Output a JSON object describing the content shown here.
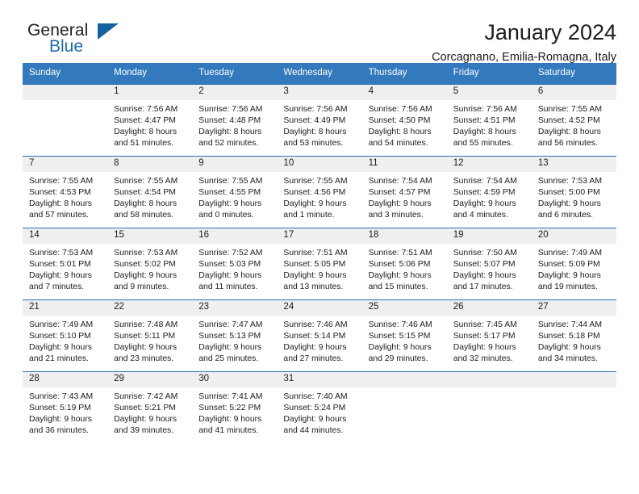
{
  "brand": {
    "name_part1": "General",
    "name_part2": "Blue"
  },
  "header": {
    "title": "January 2024",
    "subtitle": "Corcagnano, Emilia-Romagna, Italy"
  },
  "colors": {
    "header_blue": "#3279bd",
    "row_divider_blue": "#2c6fae",
    "day_band_gray": "#efefef",
    "logo_blue": "#1d6cb5",
    "text": "#1c1c1c"
  },
  "weekdays": [
    "Sunday",
    "Monday",
    "Tuesday",
    "Wednesday",
    "Thursday",
    "Friday",
    "Saturday"
  ],
  "weeks": [
    [
      {
        "day": "",
        "sunrise": "",
        "sunset": "",
        "daylight_line1": "",
        "daylight_line2": ""
      },
      {
        "day": "1",
        "sunrise": "Sunrise: 7:56 AM",
        "sunset": "Sunset: 4:47 PM",
        "daylight_line1": "Daylight: 8 hours",
        "daylight_line2": "and 51 minutes."
      },
      {
        "day": "2",
        "sunrise": "Sunrise: 7:56 AM",
        "sunset": "Sunset: 4:48 PM",
        "daylight_line1": "Daylight: 8 hours",
        "daylight_line2": "and 52 minutes."
      },
      {
        "day": "3",
        "sunrise": "Sunrise: 7:56 AM",
        "sunset": "Sunset: 4:49 PM",
        "daylight_line1": "Daylight: 8 hours",
        "daylight_line2": "and 53 minutes."
      },
      {
        "day": "4",
        "sunrise": "Sunrise: 7:56 AM",
        "sunset": "Sunset: 4:50 PM",
        "daylight_line1": "Daylight: 8 hours",
        "daylight_line2": "and 54 minutes."
      },
      {
        "day": "5",
        "sunrise": "Sunrise: 7:56 AM",
        "sunset": "Sunset: 4:51 PM",
        "daylight_line1": "Daylight: 8 hours",
        "daylight_line2": "and 55 minutes."
      },
      {
        "day": "6",
        "sunrise": "Sunrise: 7:55 AM",
        "sunset": "Sunset: 4:52 PM",
        "daylight_line1": "Daylight: 8 hours",
        "daylight_line2": "and 56 minutes."
      }
    ],
    [
      {
        "day": "7",
        "sunrise": "Sunrise: 7:55 AM",
        "sunset": "Sunset: 4:53 PM",
        "daylight_line1": "Daylight: 8 hours",
        "daylight_line2": "and 57 minutes."
      },
      {
        "day": "8",
        "sunrise": "Sunrise: 7:55 AM",
        "sunset": "Sunset: 4:54 PM",
        "daylight_line1": "Daylight: 8 hours",
        "daylight_line2": "and 58 minutes."
      },
      {
        "day": "9",
        "sunrise": "Sunrise: 7:55 AM",
        "sunset": "Sunset: 4:55 PM",
        "daylight_line1": "Daylight: 9 hours",
        "daylight_line2": "and 0 minutes."
      },
      {
        "day": "10",
        "sunrise": "Sunrise: 7:55 AM",
        "sunset": "Sunset: 4:56 PM",
        "daylight_line1": "Daylight: 9 hours",
        "daylight_line2": "and 1 minute."
      },
      {
        "day": "11",
        "sunrise": "Sunrise: 7:54 AM",
        "sunset": "Sunset: 4:57 PM",
        "daylight_line1": "Daylight: 9 hours",
        "daylight_line2": "and 3 minutes."
      },
      {
        "day": "12",
        "sunrise": "Sunrise: 7:54 AM",
        "sunset": "Sunset: 4:59 PM",
        "daylight_line1": "Daylight: 9 hours",
        "daylight_line2": "and 4 minutes."
      },
      {
        "day": "13",
        "sunrise": "Sunrise: 7:53 AM",
        "sunset": "Sunset: 5:00 PM",
        "daylight_line1": "Daylight: 9 hours",
        "daylight_line2": "and 6 minutes."
      }
    ],
    [
      {
        "day": "14",
        "sunrise": "Sunrise: 7:53 AM",
        "sunset": "Sunset: 5:01 PM",
        "daylight_line1": "Daylight: 9 hours",
        "daylight_line2": "and 7 minutes."
      },
      {
        "day": "15",
        "sunrise": "Sunrise: 7:53 AM",
        "sunset": "Sunset: 5:02 PM",
        "daylight_line1": "Daylight: 9 hours",
        "daylight_line2": "and 9 minutes."
      },
      {
        "day": "16",
        "sunrise": "Sunrise: 7:52 AM",
        "sunset": "Sunset: 5:03 PM",
        "daylight_line1": "Daylight: 9 hours",
        "daylight_line2": "and 11 minutes."
      },
      {
        "day": "17",
        "sunrise": "Sunrise: 7:51 AM",
        "sunset": "Sunset: 5:05 PM",
        "daylight_line1": "Daylight: 9 hours",
        "daylight_line2": "and 13 minutes."
      },
      {
        "day": "18",
        "sunrise": "Sunrise: 7:51 AM",
        "sunset": "Sunset: 5:06 PM",
        "daylight_line1": "Daylight: 9 hours",
        "daylight_line2": "and 15 minutes."
      },
      {
        "day": "19",
        "sunrise": "Sunrise: 7:50 AM",
        "sunset": "Sunset: 5:07 PM",
        "daylight_line1": "Daylight: 9 hours",
        "daylight_line2": "and 17 minutes."
      },
      {
        "day": "20",
        "sunrise": "Sunrise: 7:49 AM",
        "sunset": "Sunset: 5:09 PM",
        "daylight_line1": "Daylight: 9 hours",
        "daylight_line2": "and 19 minutes."
      }
    ],
    [
      {
        "day": "21",
        "sunrise": "Sunrise: 7:49 AM",
        "sunset": "Sunset: 5:10 PM",
        "daylight_line1": "Daylight: 9 hours",
        "daylight_line2": "and 21 minutes."
      },
      {
        "day": "22",
        "sunrise": "Sunrise: 7:48 AM",
        "sunset": "Sunset: 5:11 PM",
        "daylight_line1": "Daylight: 9 hours",
        "daylight_line2": "and 23 minutes."
      },
      {
        "day": "23",
        "sunrise": "Sunrise: 7:47 AM",
        "sunset": "Sunset: 5:13 PM",
        "daylight_line1": "Daylight: 9 hours",
        "daylight_line2": "and 25 minutes."
      },
      {
        "day": "24",
        "sunrise": "Sunrise: 7:46 AM",
        "sunset": "Sunset: 5:14 PM",
        "daylight_line1": "Daylight: 9 hours",
        "daylight_line2": "and 27 minutes."
      },
      {
        "day": "25",
        "sunrise": "Sunrise: 7:46 AM",
        "sunset": "Sunset: 5:15 PM",
        "daylight_line1": "Daylight: 9 hours",
        "daylight_line2": "and 29 minutes."
      },
      {
        "day": "26",
        "sunrise": "Sunrise: 7:45 AM",
        "sunset": "Sunset: 5:17 PM",
        "daylight_line1": "Daylight: 9 hours",
        "daylight_line2": "and 32 minutes."
      },
      {
        "day": "27",
        "sunrise": "Sunrise: 7:44 AM",
        "sunset": "Sunset: 5:18 PM",
        "daylight_line1": "Daylight: 9 hours",
        "daylight_line2": "and 34 minutes."
      }
    ],
    [
      {
        "day": "28",
        "sunrise": "Sunrise: 7:43 AM",
        "sunset": "Sunset: 5:19 PM",
        "daylight_line1": "Daylight: 9 hours",
        "daylight_line2": "and 36 minutes."
      },
      {
        "day": "29",
        "sunrise": "Sunrise: 7:42 AM",
        "sunset": "Sunset: 5:21 PM",
        "daylight_line1": "Daylight: 9 hours",
        "daylight_line2": "and 39 minutes."
      },
      {
        "day": "30",
        "sunrise": "Sunrise: 7:41 AM",
        "sunset": "Sunset: 5:22 PM",
        "daylight_line1": "Daylight: 9 hours",
        "daylight_line2": "and 41 minutes."
      },
      {
        "day": "31",
        "sunrise": "Sunrise: 7:40 AM",
        "sunset": "Sunset: 5:24 PM",
        "daylight_line1": "Daylight: 9 hours",
        "daylight_line2": "and 44 minutes."
      },
      {
        "day": "",
        "sunrise": "",
        "sunset": "",
        "daylight_line1": "",
        "daylight_line2": ""
      },
      {
        "day": "",
        "sunrise": "",
        "sunset": "",
        "daylight_line1": "",
        "daylight_line2": ""
      },
      {
        "day": "",
        "sunrise": "",
        "sunset": "",
        "daylight_line1": "",
        "daylight_line2": ""
      }
    ]
  ]
}
